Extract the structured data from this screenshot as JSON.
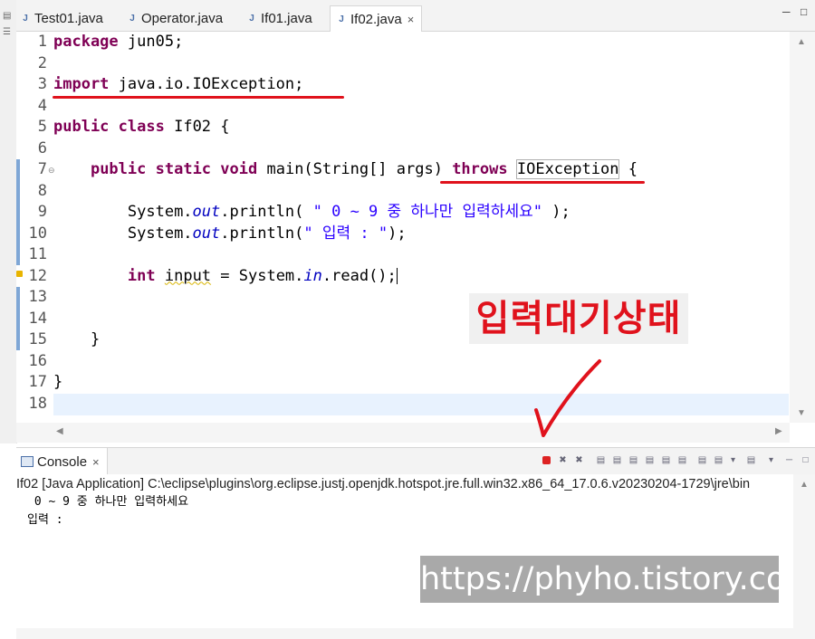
{
  "tabs": [
    {
      "label": "Test01.java",
      "active": false
    },
    {
      "label": "Operator.java",
      "active": false
    },
    {
      "label": "If01.java",
      "active": false
    },
    {
      "label": "If02.java",
      "active": true
    }
  ],
  "editor": {
    "line_numbers": [
      "1",
      "2",
      "3",
      "4",
      "5",
      "6",
      "7",
      "8",
      "9",
      "10",
      "11",
      "12",
      "13",
      "14",
      "15",
      "16",
      "17",
      "18"
    ],
    "line1": {
      "kw": "package",
      "rest": " jun05;"
    },
    "line3": {
      "kw": "import",
      "rest": " java.io.IOException;"
    },
    "line5": {
      "kw1": "public",
      "kw2": "class",
      "rest": " If02 {"
    },
    "line7": {
      "kw1": "public",
      "kw2": "static",
      "kw3": "void",
      "mid": " main(String[] args) ",
      "kw4": "throws",
      "exc": "IOException",
      "tail": " {"
    },
    "line9": {
      "pre": "System.",
      "fld": "out",
      "mid": ".println( ",
      "str": "\" 0 ~ 9 중 하나만 입력하세요\"",
      "tail": " );"
    },
    "line10": {
      "pre": "System.",
      "fld": "out",
      "mid": ".println(",
      "str": "\" 입력 : \"",
      "tail": ");"
    },
    "line12": {
      "kw": "int",
      "var": "input",
      "mid": " = System.",
      "fld": "in",
      "tail": ".read();"
    },
    "line15": {
      "text": "}"
    },
    "line17": {
      "text": "}"
    }
  },
  "annotation": {
    "label": "입력대기상태",
    "color": "#e0121c"
  },
  "console": {
    "tab_label": "Console",
    "launch_info": "If02 [Java Application] C:\\eclipse\\plugins\\org.eclipse.justj.openjdk.hotspot.jre.full.win32.x86_64_17.0.6.v20230204-1729\\jre\\bin",
    "output": [
      " 0 ~ 9 중 하나만 입력하세요",
      "입력 : "
    ]
  },
  "watermark": "https://phyho.tistory.com",
  "icons": {
    "tab": "java-file-icon",
    "close": "×",
    "console": "console-icon",
    "stop": "terminate-icon",
    "check": "red-check-mark"
  }
}
